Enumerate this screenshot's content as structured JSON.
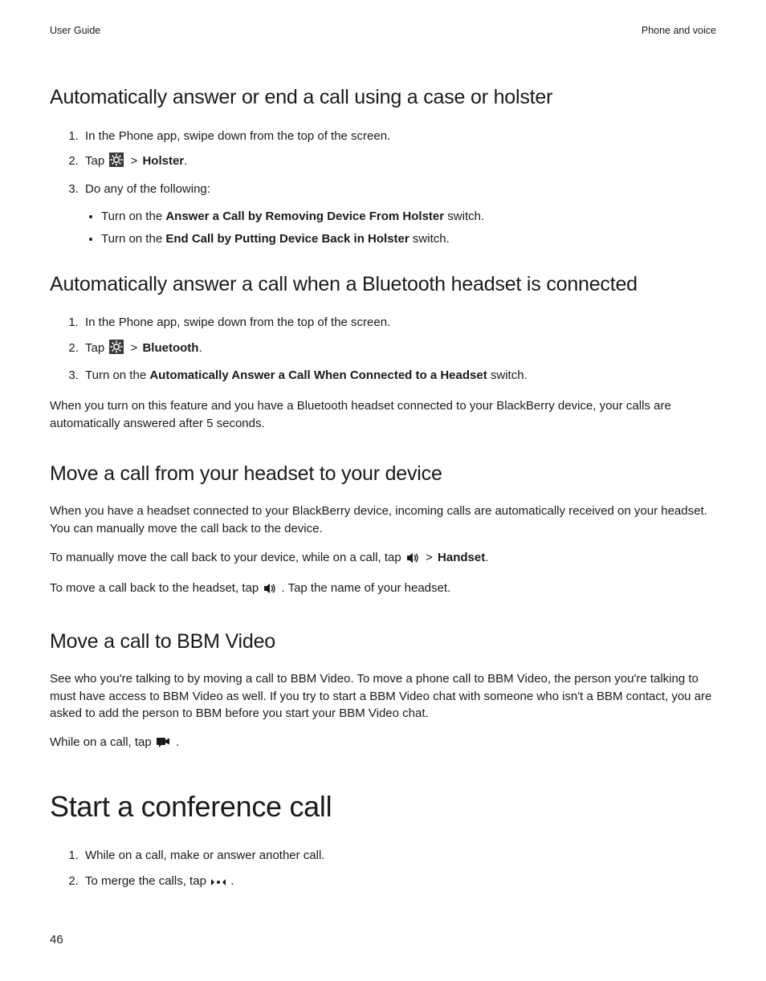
{
  "header": {
    "left": "User Guide",
    "right": "Phone and voice"
  },
  "sec1": {
    "title": "Automatically answer or end a call using a case or holster",
    "step1": "In the Phone app, swipe down from the top of the screen.",
    "step2_lead": "Tap ",
    "step2_gt": " > ",
    "step2_bold": "Holster",
    "step2_tail": ".",
    "step3": "Do any of the following:",
    "bullet1_lead": "Turn on the ",
    "bullet1_bold": "Answer a Call by Removing Device From Holster",
    "bullet1_tail": " switch.",
    "bullet2_lead": "Turn on the ",
    "bullet2_bold": "End Call by Putting Device Back in Holster",
    "bullet2_tail": " switch."
  },
  "sec2": {
    "title": "Automatically answer a call when a Bluetooth headset is connected",
    "step1": "In the Phone app, swipe down from the top of the screen.",
    "step2_lead": "Tap ",
    "step2_gt": " > ",
    "step2_bold": "Bluetooth",
    "step2_tail": ".",
    "step3_lead": "Turn on the ",
    "step3_bold": "Automatically Answer a Call When Connected to a Headset",
    "step3_tail": " switch.",
    "para": "When you turn on this feature and you have a Bluetooth headset connected to your BlackBerry device, your calls are automatically answered after 5 seconds."
  },
  "sec3": {
    "title": "Move a call from your headset to your device",
    "para1": "When you have a headset connected to your BlackBerry device, incoming calls are automatically received on your headset. You can manually move the call back to the device.",
    "para2_lead": "To manually move the call back to your device, while on a call, tap ",
    "para2_gt": " > ",
    "para2_bold": "Handset",
    "para2_tail": ".",
    "para3_lead": "To move a call back to the headset, tap ",
    "para3_tail": ". Tap the name of your headset."
  },
  "sec4": {
    "title": "Move a call to BBM Video",
    "para1": "See who you're talking to by moving a call to BBM Video. To move a phone call to BBM Video, the person you're talking to must have access to BBM Video as well. If you try to start a BBM Video chat with someone who isn't a BBM contact, you are asked to add the person to BBM before you start your BBM Video chat.",
    "para2_lead": "While on a call, tap ",
    "para2_tail": "."
  },
  "sec5": {
    "title": "Start a conference call",
    "step1": "While on a call, make or answer another call.",
    "step2_lead": "To merge the calls, tap ",
    "step2_tail": "."
  },
  "page_number": "46"
}
